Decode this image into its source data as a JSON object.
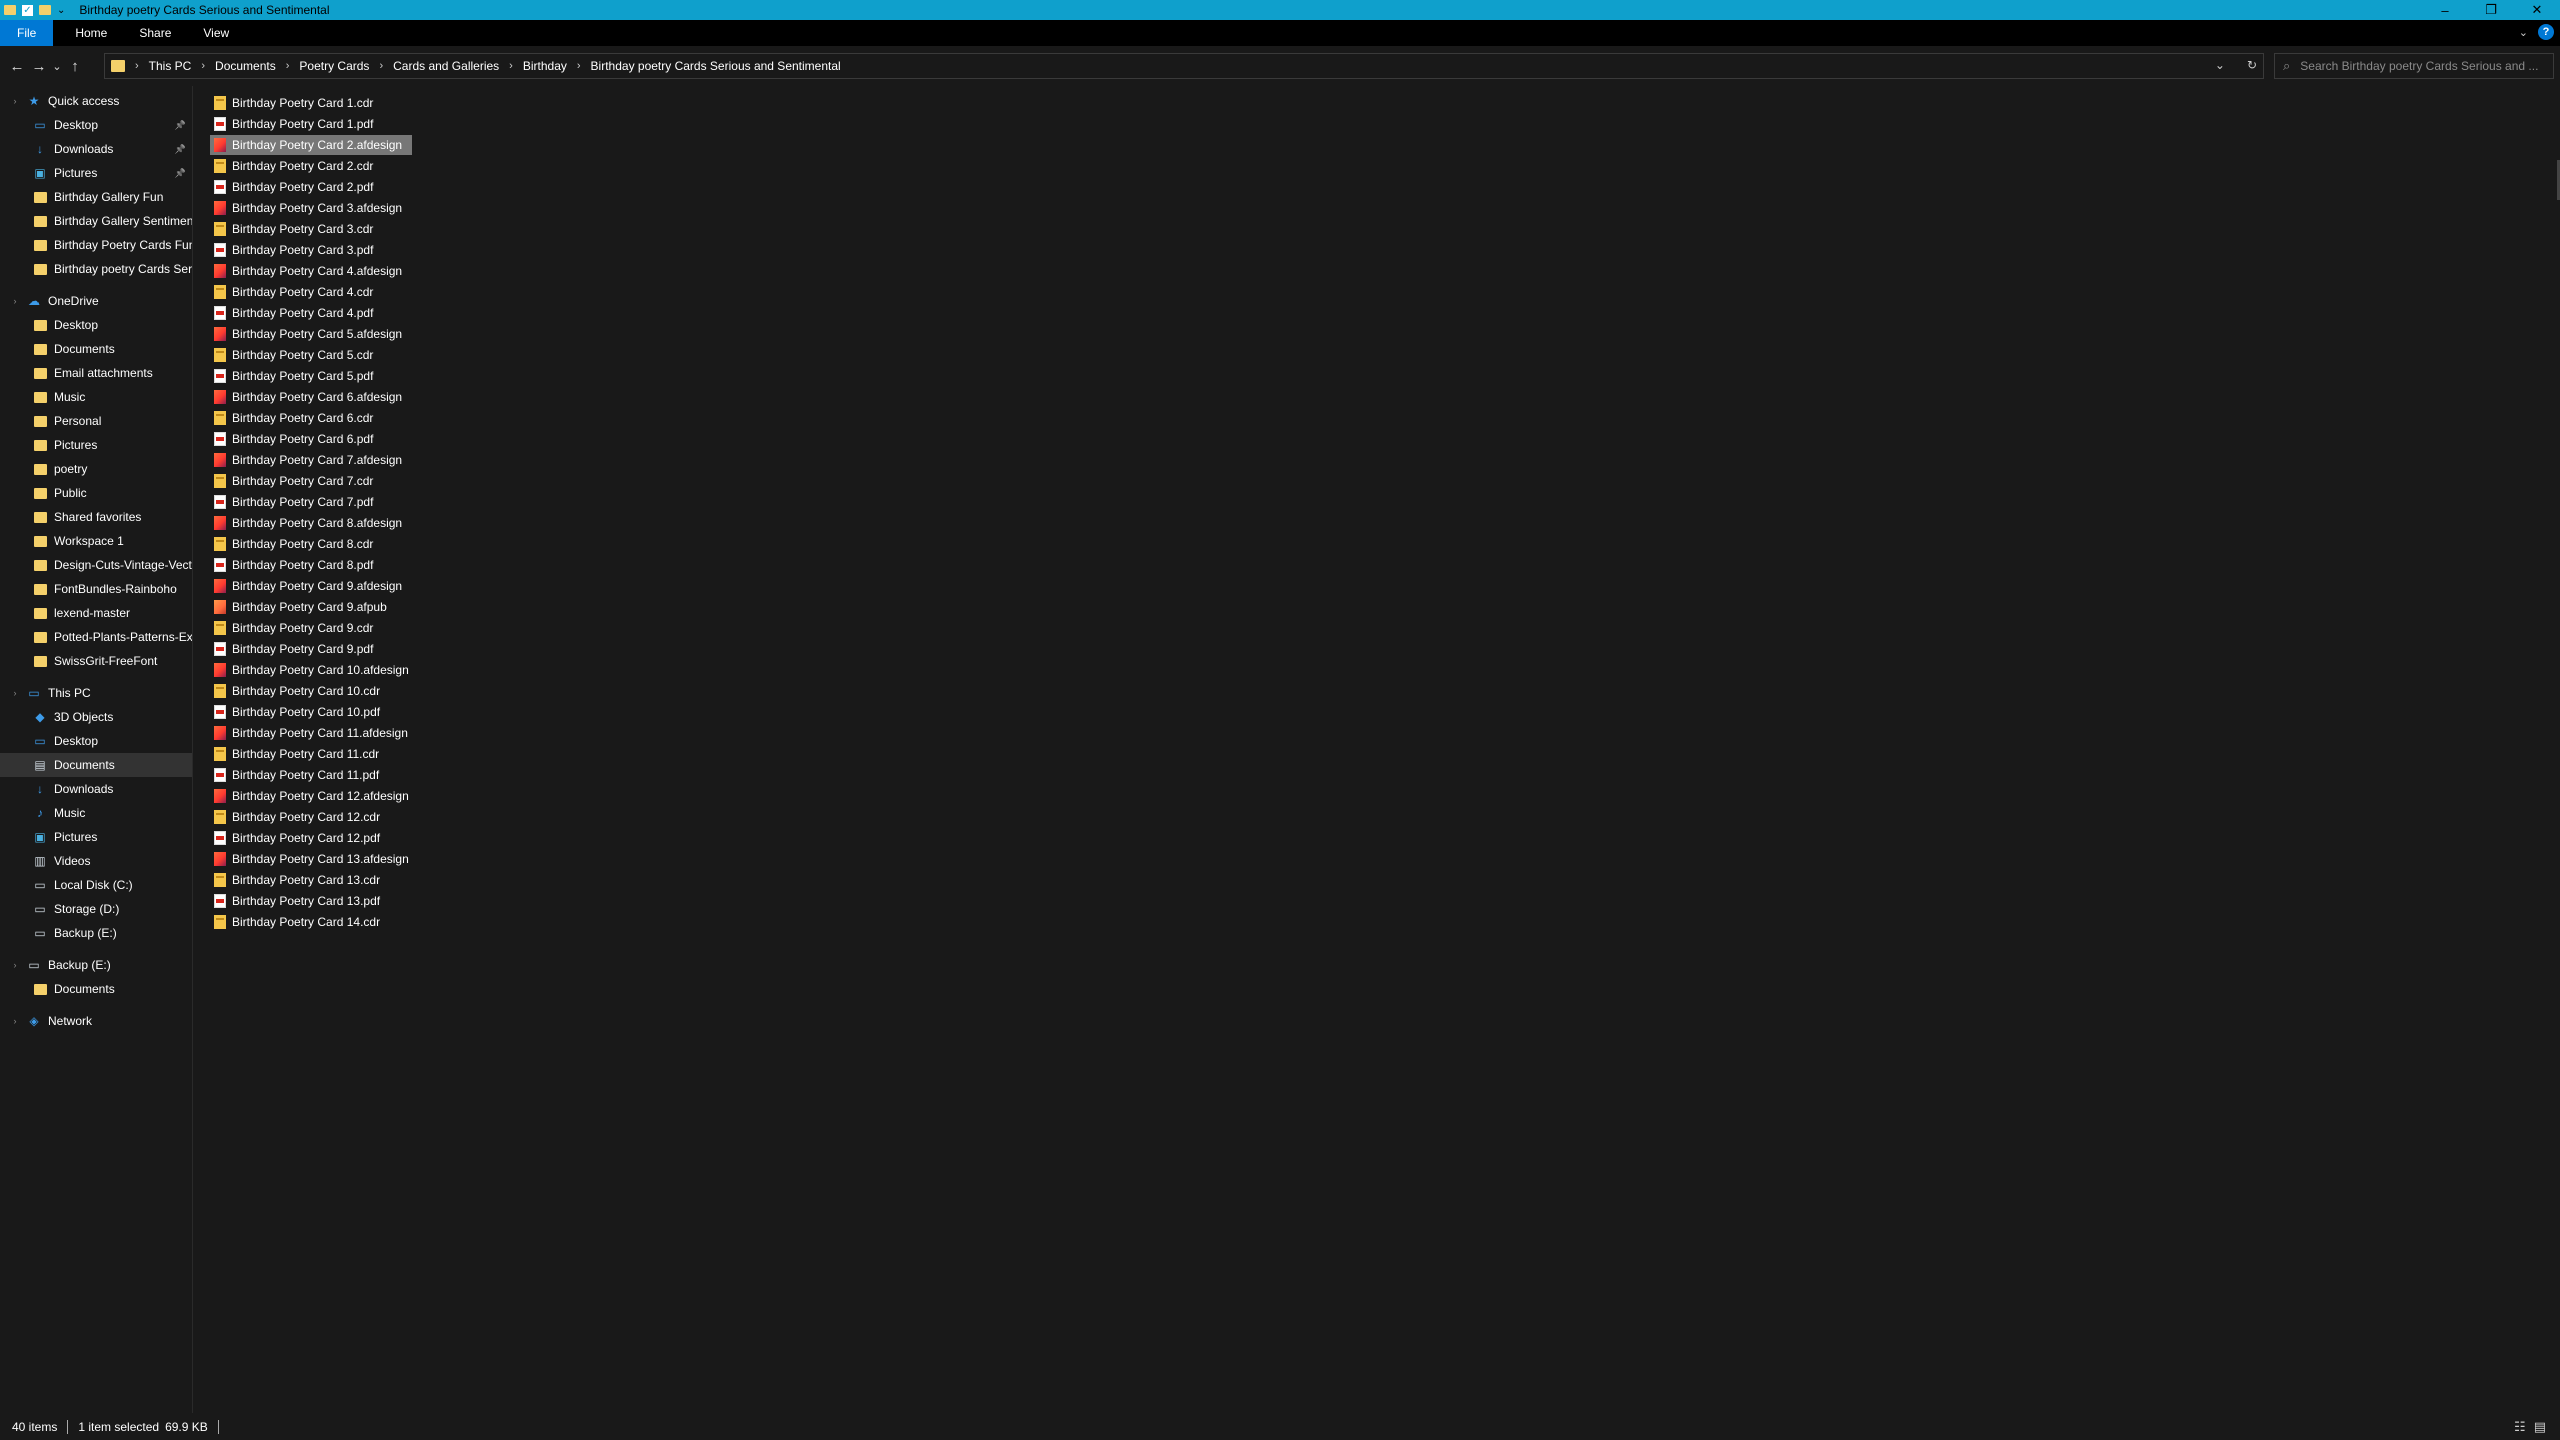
{
  "window": {
    "title": "Birthday poetry Cards Serious and Sentimental",
    "controls": {
      "minimize": "–",
      "maximize": "❐",
      "close": "✕"
    }
  },
  "ribbon": {
    "tabs": [
      "File",
      "Home",
      "Share",
      "View"
    ],
    "help": "?"
  },
  "nav": {
    "back": "←",
    "forward": "→",
    "recent": "⌄",
    "up": "↑"
  },
  "address": {
    "crumbs": [
      "This PC",
      "Documents",
      "Poetry Cards",
      "Cards and Galleries",
      "Birthday",
      "Birthday poetry Cards Serious and Sentimental"
    ],
    "dropdown": "⌄",
    "refresh": "↻"
  },
  "search": {
    "placeholder": "Search Birthday poetry Cards Serious and ..."
  },
  "sidebar": {
    "quick_access": {
      "label": "Quick access",
      "items": [
        {
          "label": "Desktop",
          "pinned": true
        },
        {
          "label": "Downloads",
          "pinned": true
        },
        {
          "label": "Pictures",
          "pinned": true
        },
        {
          "label": "Birthday Gallery Fun"
        },
        {
          "label": "Birthday Gallery Sentiment"
        },
        {
          "label": "Birthday Poetry Cards Fun"
        },
        {
          "label": "Birthday poetry Cards Serio"
        }
      ]
    },
    "onedrive": {
      "label": "OneDrive",
      "items": [
        "Desktop",
        "Documents",
        "Email attachments",
        "Music",
        "Personal",
        "Pictures",
        "poetry",
        "Public",
        "Shared favorites",
        "Workspace 1",
        "Design-Cuts-Vintage-Vecto",
        "FontBundles-Rainboho",
        "lexend-master",
        "Potted-Plants-Patterns-Ext",
        "SwissGrit-FreeFont"
      ]
    },
    "this_pc": {
      "label": "This PC",
      "items": [
        "3D Objects",
        "Desktop",
        "Documents",
        "Downloads",
        "Music",
        "Pictures",
        "Videos",
        "Local Disk (C:)",
        "Storage (D:)",
        "Backup (E:)"
      ],
      "selected": "Documents"
    },
    "backup": {
      "label": "Backup (E:)",
      "items": [
        "Documents"
      ]
    },
    "network": {
      "label": "Network"
    }
  },
  "files": [
    {
      "name": "Birthday Poetry Card 1.cdr",
      "type": "cdr"
    },
    {
      "name": "Birthday Poetry Card 1.pdf",
      "type": "pdf"
    },
    {
      "name": "Birthday Poetry Card 2.afdesign",
      "type": "afdesign",
      "selected": true
    },
    {
      "name": "Birthday Poetry Card 2.cdr",
      "type": "cdr"
    },
    {
      "name": "Birthday Poetry Card 2.pdf",
      "type": "pdf"
    },
    {
      "name": "Birthday Poetry Card 3.afdesign",
      "type": "afdesign"
    },
    {
      "name": "Birthday Poetry Card 3.cdr",
      "type": "cdr"
    },
    {
      "name": "Birthday Poetry Card 3.pdf",
      "type": "pdf"
    },
    {
      "name": "Birthday Poetry Card 4.afdesign",
      "type": "afdesign"
    },
    {
      "name": "Birthday Poetry Card 4.cdr",
      "type": "cdr"
    },
    {
      "name": "Birthday Poetry Card 4.pdf",
      "type": "pdf"
    },
    {
      "name": "Birthday Poetry Card 5.afdesign",
      "type": "afdesign"
    },
    {
      "name": "Birthday Poetry Card 5.cdr",
      "type": "cdr"
    },
    {
      "name": "Birthday Poetry Card 5.pdf",
      "type": "pdf"
    },
    {
      "name": "Birthday Poetry Card 6.afdesign",
      "type": "afdesign"
    },
    {
      "name": "Birthday Poetry Card 6.cdr",
      "type": "cdr"
    },
    {
      "name": "Birthday Poetry Card 6.pdf",
      "type": "pdf"
    },
    {
      "name": "Birthday Poetry Card 7.afdesign",
      "type": "afdesign"
    },
    {
      "name": "Birthday Poetry Card 7.cdr",
      "type": "cdr"
    },
    {
      "name": "Birthday Poetry Card 7.pdf",
      "type": "pdf"
    },
    {
      "name": "Birthday Poetry Card 8.afdesign",
      "type": "afdesign"
    },
    {
      "name": "Birthday Poetry Card 8.cdr",
      "type": "cdr"
    },
    {
      "name": "Birthday Poetry Card 8.pdf",
      "type": "pdf"
    },
    {
      "name": "Birthday Poetry Card 9.afdesign",
      "type": "afdesign"
    },
    {
      "name": "Birthday Poetry Card 9.afpub",
      "type": "afpub"
    },
    {
      "name": "Birthday Poetry Card 9.cdr",
      "type": "cdr"
    },
    {
      "name": "Birthday Poetry Card 9.pdf",
      "type": "pdf"
    },
    {
      "name": "Birthday Poetry Card 10.afdesign",
      "type": "afdesign"
    },
    {
      "name": "Birthday Poetry Card 10.cdr",
      "type": "cdr"
    },
    {
      "name": "Birthday Poetry Card 10.pdf",
      "type": "pdf"
    },
    {
      "name": "Birthday Poetry Card 11.afdesign",
      "type": "afdesign"
    },
    {
      "name": "Birthday Poetry Card 11.cdr",
      "type": "cdr"
    },
    {
      "name": "Birthday Poetry Card 11.pdf",
      "type": "pdf"
    },
    {
      "name": "Birthday Poetry Card 12.afdesign",
      "type": "afdesign"
    },
    {
      "name": "Birthday Poetry Card 12.cdr",
      "type": "cdr"
    },
    {
      "name": "Birthday Poetry Card 12.pdf",
      "type": "pdf"
    },
    {
      "name": "Birthday Poetry Card 13.afdesign",
      "type": "afdesign"
    },
    {
      "name": "Birthday Poetry Card 13.cdr",
      "type": "cdr"
    },
    {
      "name": "Birthday Poetry Card 13.pdf",
      "type": "pdf"
    },
    {
      "name": "Birthday Poetry Card 14.cdr",
      "type": "cdr"
    }
  ],
  "status": {
    "item_count": "40 items",
    "selection": "1 item selected",
    "size": "69.9 KB"
  },
  "colors": {
    "titlebar": "#0fa0cc",
    "file_tab": "#0078d4",
    "background": "#191919",
    "folder": "#f4d06a",
    "selection": "#777777"
  }
}
